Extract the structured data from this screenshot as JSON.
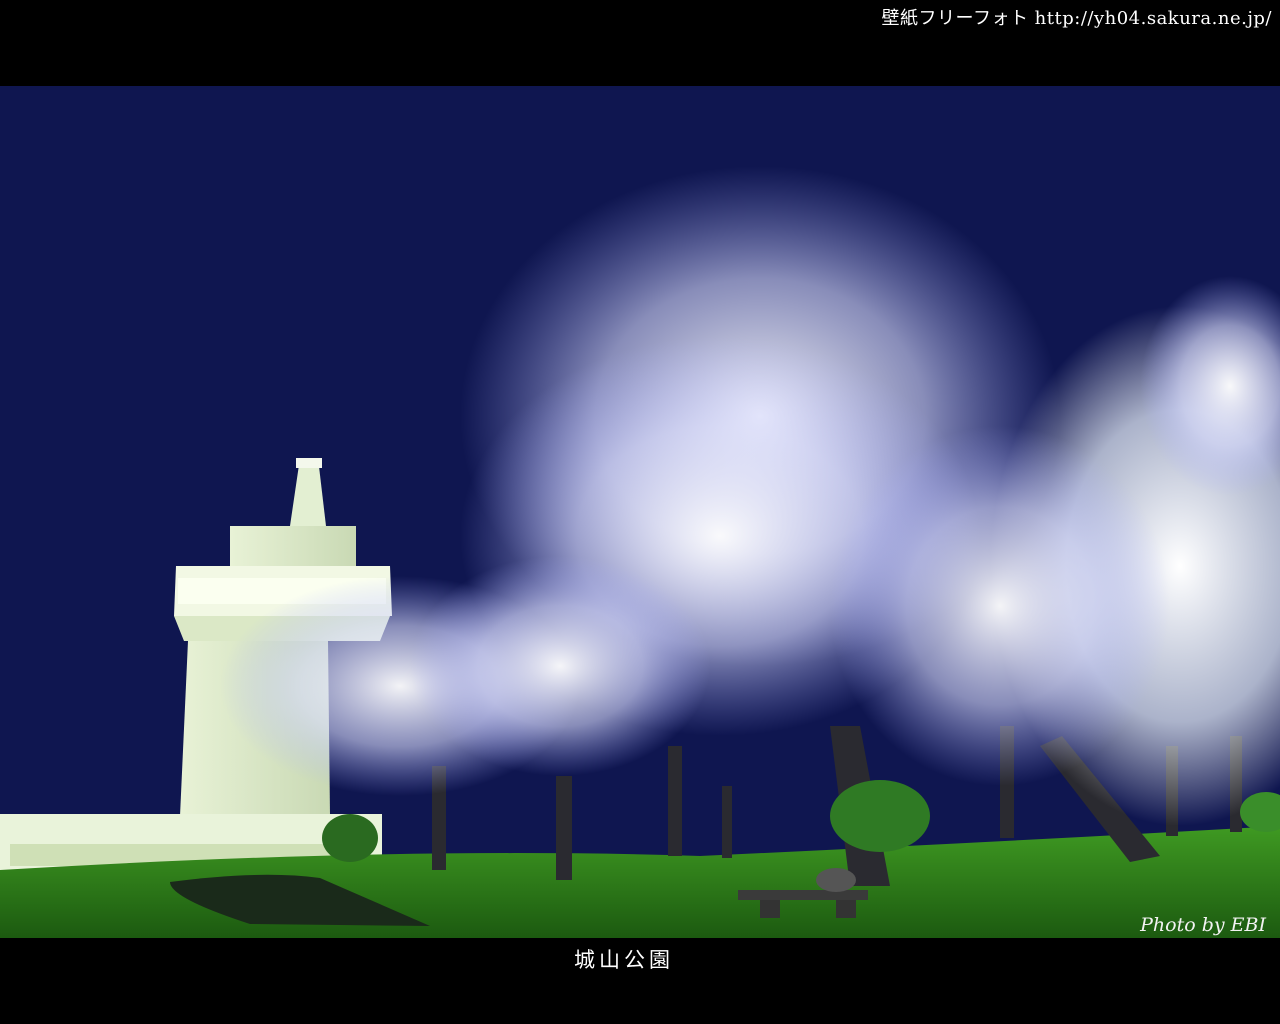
{
  "header": {
    "watermark": "壁紙フリーフォト http://yh04.sakura.ne.jp/"
  },
  "photo": {
    "credit": "Photo by EBI"
  },
  "footer": {
    "caption": "城山公園"
  }
}
